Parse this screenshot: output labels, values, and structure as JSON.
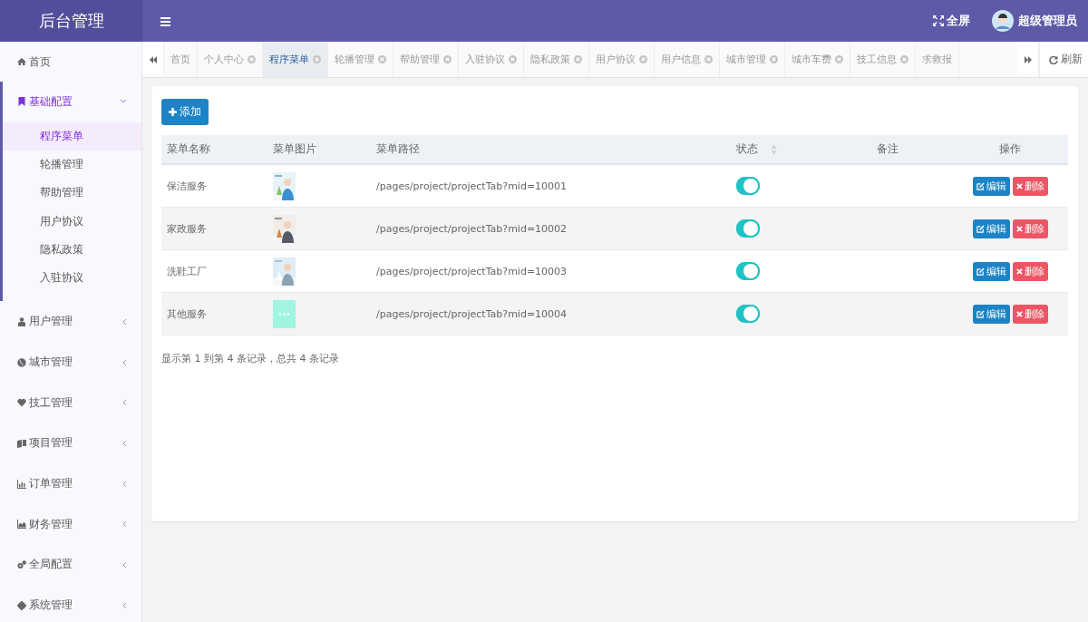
{
  "brand": "后台管理",
  "header": {
    "fullscreen": "全屏",
    "user": "超级管理员"
  },
  "sidebar": {
    "items": [
      {
        "label": "首页",
        "expanded": false
      },
      {
        "label": "基础配置",
        "expanded": true,
        "children": [
          {
            "label": "程序菜单",
            "selected": true
          },
          {
            "label": "轮播管理",
            "selected": false
          },
          {
            "label": "帮助管理",
            "selected": false
          },
          {
            "label": "用户协议",
            "selected": false
          },
          {
            "label": "隐私政策",
            "selected": false
          },
          {
            "label": "入驻协议",
            "selected": false
          }
        ]
      },
      {
        "label": "用户管理",
        "expanded": false
      },
      {
        "label": "城市管理",
        "expanded": false
      },
      {
        "label": "技工管理",
        "expanded": false
      },
      {
        "label": "项目管理",
        "expanded": false
      },
      {
        "label": "订单管理",
        "expanded": false
      },
      {
        "label": "财务管理",
        "expanded": false
      },
      {
        "label": "全局配置",
        "expanded": false
      },
      {
        "label": "系统管理",
        "expanded": false
      }
    ]
  },
  "tabs": [
    {
      "label": "首页",
      "closable": false,
      "selected": false
    },
    {
      "label": "个人中心",
      "closable": true,
      "selected": false
    },
    {
      "label": "程序菜单",
      "closable": true,
      "selected": true
    },
    {
      "label": "轮播管理",
      "closable": true,
      "selected": false
    },
    {
      "label": "帮助管理",
      "closable": true,
      "selected": false
    },
    {
      "label": "入驻协议",
      "closable": true,
      "selected": false
    },
    {
      "label": "隐私政策",
      "closable": true,
      "selected": false
    },
    {
      "label": "用户协议",
      "closable": true,
      "selected": false
    },
    {
      "label": "用户信息",
      "closable": true,
      "selected": false
    },
    {
      "label": "城市管理",
      "closable": true,
      "selected": false
    },
    {
      "label": "城市车费",
      "closable": true,
      "selected": false
    },
    {
      "label": "技工信息",
      "closable": true,
      "selected": false
    },
    {
      "label": "求救报",
      "closable": false,
      "selected": false
    }
  ],
  "refresh": "刷新",
  "add_button": "添加",
  "table": {
    "columns": [
      "菜单名称",
      "菜单图片",
      "菜单路径",
      "状态",
      "备注",
      "操作"
    ],
    "rows": [
      {
        "name": "保洁服务",
        "path": "/pages/project/projectTab?mid=10001",
        "on": true,
        "edit": "编辑",
        "delete": "删除"
      },
      {
        "name": "家政服务",
        "path": "/pages/project/projectTab?mid=10002",
        "on": true,
        "edit": "编辑",
        "delete": "删除"
      },
      {
        "name": "洗鞋工厂",
        "path": "/pages/project/projectTab?mid=10003",
        "on": true,
        "edit": "编辑",
        "delete": "删除"
      },
      {
        "name": "其他服务",
        "image": {
          "kind": "more"
        },
        "path": "/pages/project/projectTab?mid=10004",
        "on": true,
        "edit": "编辑",
        "delete": "删除"
      }
    ]
  },
  "pagination": "显示第 1 到第 4 条记录，总共 4 条记录"
}
